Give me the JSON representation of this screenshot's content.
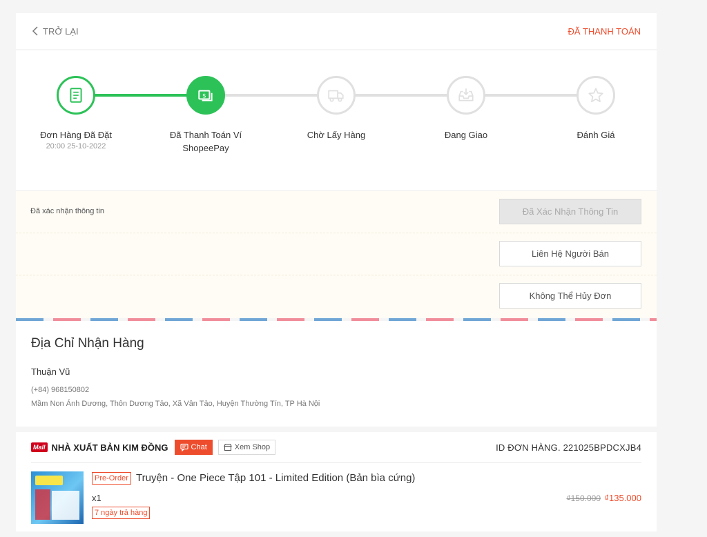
{
  "header": {
    "back_label": "TRỞ LẠI",
    "status": "ĐÃ THANH TOÁN"
  },
  "stepper": {
    "steps": [
      {
        "label": "Đơn Hàng Đã Đặt",
        "time": "20:00 25-10-2022",
        "icon": "receipt-icon",
        "state": "done"
      },
      {
        "label": "Đã Thanh Toán Ví ShopeePay",
        "time": "",
        "icon": "money-icon",
        "state": "current"
      },
      {
        "label": "Chờ Lấy Hàng",
        "time": "",
        "icon": "truck-icon",
        "state": "pending"
      },
      {
        "label": "Đang Giao",
        "time": "",
        "icon": "inbox-download-icon",
        "state": "pending"
      },
      {
        "label": "Đánh Giá",
        "time": "",
        "icon": "star-icon",
        "state": "pending"
      }
    ],
    "colors": {
      "done": "#2dc258",
      "pending": "#e0e0e0"
    }
  },
  "actions": {
    "note": "Đã xác nhận thông tin",
    "confirmed_button": "Đã Xác Nhận Thông Tin",
    "contact_button": "Liên Hệ Người Bán",
    "cancel_button": "Không Thể Hủy Đơn"
  },
  "address": {
    "title": "Địa Chỉ Nhận Hàng",
    "name": "Thuận Vũ",
    "phone": "(+84) 968150802",
    "line": "Mầm Non Ánh Dương, Thôn Dương Tảo, Xã Vân Tảo, Huyện Thường Tín, TP Hà Nội"
  },
  "order": {
    "mall_badge": "Mall",
    "shop_name": "NHÀ XUẤT BẢN KIM ĐỒNG",
    "chat_label": "Chat",
    "view_shop_label": "Xem Shop",
    "order_id": "ID ĐƠN HÀNG. 221025BPDCXJB4",
    "product": {
      "tag": "Pre-Order",
      "name": "Truyện - One Piece Tập 101 - Limited Edition (Bản bìa cứng)",
      "quantity": "x1",
      "return_policy": "7 ngày trả hàng",
      "price_old": "₫150.000",
      "price_new": "₫135.000"
    }
  },
  "accent_color": "#ee4d2d"
}
